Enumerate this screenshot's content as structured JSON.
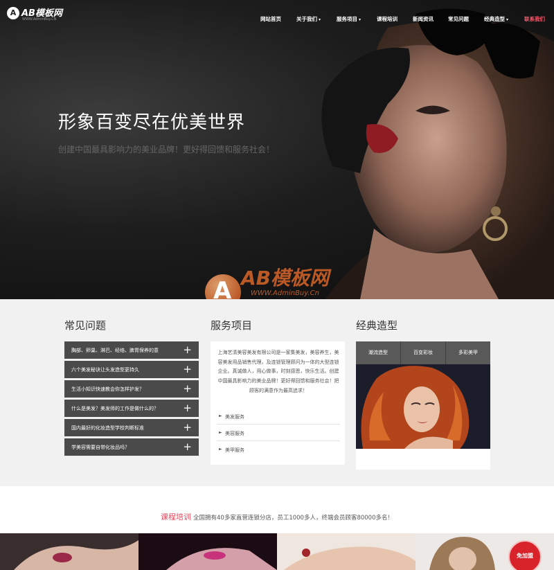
{
  "logo": {
    "text": "AB模板网",
    "sub": "WWW.AdminBuy.CN",
    "mark": "A"
  },
  "nav": [
    {
      "label": "网站首页",
      "caret": false,
      "active": false
    },
    {
      "label": "关于我们",
      "caret": true,
      "active": false
    },
    {
      "label": "服务项目",
      "caret": true,
      "active": false
    },
    {
      "label": "课程培训",
      "caret": false,
      "active": false
    },
    {
      "label": "新闻资讯",
      "caret": false,
      "active": false
    },
    {
      "label": "常见问题",
      "caret": false,
      "active": false
    },
    {
      "label": "经典造型",
      "caret": true,
      "active": false
    },
    {
      "label": "联系我们",
      "caret": false,
      "active": true
    }
  ],
  "hero": {
    "title": "形象百变尽在优美世界",
    "subtitle": "创建中国最具影响力的美业品牌！更好得回馈和服务社会！"
  },
  "watermark": {
    "text": "AB模板网",
    "url": "WWW.AdminBuy.Cn",
    "mark": "A"
  },
  "faq": {
    "title": "常见问题",
    "items": [
      "胸部、卵巢、淋巴、经络、脾胃保养的意",
      "六个美发秘诀让头发造型更持久",
      "生活小知识快速教会你怎样护发？",
      "什么是美发？美发师的工作是做什么的？",
      "国内最好的化妆造型学校判断标准",
      "学美容需要自带化妆品吗？"
    ],
    "expand_symbol": "+"
  },
  "services": {
    "title": "服务项目",
    "description": "上海艺清美容美发有限公司是一家集美发，美容养生，美容美发用品销售代理，及连锁管理顾问为一体的大型连锁企业。真诚做人，用心做事，时刻感恩，快乐生活。创建中国最具影响力的美业品牌！更好得回馈和服务社会！把顾客的满意作为最高追求！",
    "links": [
      "美发服务",
      "美容服务",
      "美甲服务"
    ],
    "arrow": "►"
  },
  "classic": {
    "title": "经典造型",
    "tabs": [
      "潮流造型",
      "百变彩妆",
      "多彩美甲"
    ]
  },
  "course": {
    "highlight": "课程培训",
    "text": "全国拥有40多家直营连锁分店，员工1000多人，终端会员顾客80000多名！"
  },
  "free_button": "免加盟",
  "colors": {
    "accent_red": "#e8475b",
    "nav_active": "#ff5a6e",
    "faq_bg": "#4a4a4a",
    "tab_bg": "#595959",
    "watermark": "#d9662a"
  }
}
